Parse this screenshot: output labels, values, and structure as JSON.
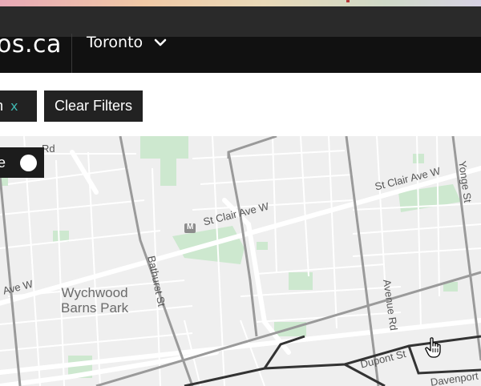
{
  "header": {
    "logo_text": "os.ca",
    "city": "Toronto"
  },
  "filters": {
    "active_chip_label": "n",
    "active_chip_remove": "x",
    "clear_label": "Clear Filters"
  },
  "map": {
    "toggle_label": "e",
    "labels": {
      "rd_top": "Rd",
      "st_clair_left": "St Clair Ave W",
      "st_clair_right": "St Clair Ave W",
      "ave_w_left": "Ave W",
      "bathurst": "Bathurst St",
      "avenue_rd": "Avenue Rd",
      "yonge": "Yonge St",
      "dupont": "Dupont St",
      "davenport": "Davenport R",
      "park_line1": "Wychwood",
      "park_line2": "Barns Park",
      "metro_badge": "M"
    }
  },
  "colors": {
    "header_bg": "#111111",
    "chip_bg": "#222222",
    "accent_x": "#3fb7b0",
    "map_bg": "#efefef",
    "park": "#cde8cf",
    "road": "#ffffff",
    "transit_line": "#999999"
  },
  "icons": [
    "chevron-down-icon",
    "close-icon",
    "metro-icon",
    "hand-cursor-icon"
  ]
}
